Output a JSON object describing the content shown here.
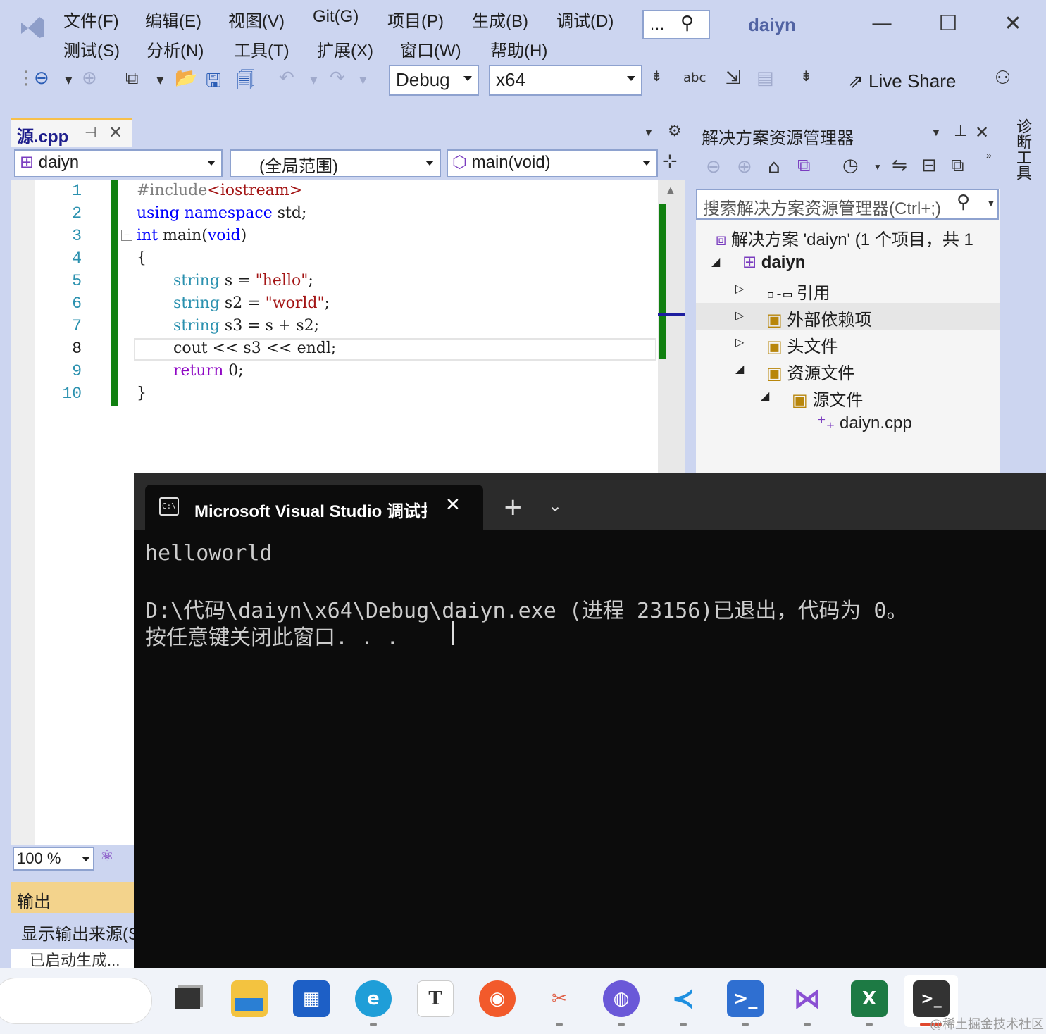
{
  "menu": {
    "row1": [
      "文件(F)",
      "编辑(E)",
      "视图(V)",
      "Git(G)",
      "项目(P)",
      "生成(B)",
      "调试(D)"
    ],
    "row2": [
      "测试(S)",
      "分析(N)",
      "工具(T)",
      "扩展(X)",
      "窗口(W)",
      "帮助(H)"
    ],
    "search_label": "…",
    "app_title": "daiyn"
  },
  "toolbar": {
    "config": "Debug",
    "platform": "x64",
    "live_share": "Live Share"
  },
  "editor": {
    "tab": "源.cpp",
    "nav_project": "daiyn",
    "nav_scope": "(全局范围)",
    "nav_function": "main(void)",
    "zoom": "100 %",
    "line_numbers": [
      "1",
      "2",
      "3",
      "4",
      "5",
      "6",
      "7",
      "8",
      "9",
      "10"
    ],
    "lines": {
      "l1a": "#include",
      "l1b": "<iostream>",
      "l2a": "using",
      "l2b": "namespace",
      "l2c": " std;",
      "l3a": "int",
      "l3b": " main(",
      "l3c": "void",
      "l3d": ")",
      "l4": "{",
      "l5a": "string",
      "l5b": " s = ",
      "l5c": "\"hello\"",
      "l5d": ";",
      "l6a": "string",
      "l6b": " s2 = ",
      "l6c": "\"world\"",
      "l6d": ";",
      "l7a": "string",
      "l7b": " s3 = s + s2;",
      "l8": "cout << s3 << endl;",
      "l9a": "return",
      "l9b": " 0;",
      "l10": "}"
    }
  },
  "output": {
    "title": "输出",
    "source_label": "显示输出来源(S",
    "body": "已启动生成..."
  },
  "solution_explorer": {
    "title": "解决方案资源管理器",
    "search_placeholder": "搜索解决方案资源管理器(Ctrl+;)",
    "solution": "解决方案 'daiyn' (1 个项目，共 1",
    "project": "daiyn",
    "references": "引用",
    "external": "外部依赖项",
    "headers": "头文件",
    "resources": "资源文件",
    "sources": "源文件",
    "file": "daiyn.cpp"
  },
  "diagnostics_tab": "诊断工具",
  "terminal": {
    "tab_title": "Microsoft Visual Studio 调试扌",
    "line1": "helloworld",
    "line2": "D:\\代码\\daiyn\\x64\\Debug\\daiyn.exe (进程 23156)已退出，代码为 0。",
    "line3": "按任意键关闭此窗口. . ."
  },
  "watermark": "@稀土掘金技术社区",
  "colors": {
    "chrome": "#ccd5f0",
    "keyword": "#0000ff",
    "type": "#2b91af",
    "string": "#a31515",
    "terminal_bg": "#0c0c0c"
  }
}
